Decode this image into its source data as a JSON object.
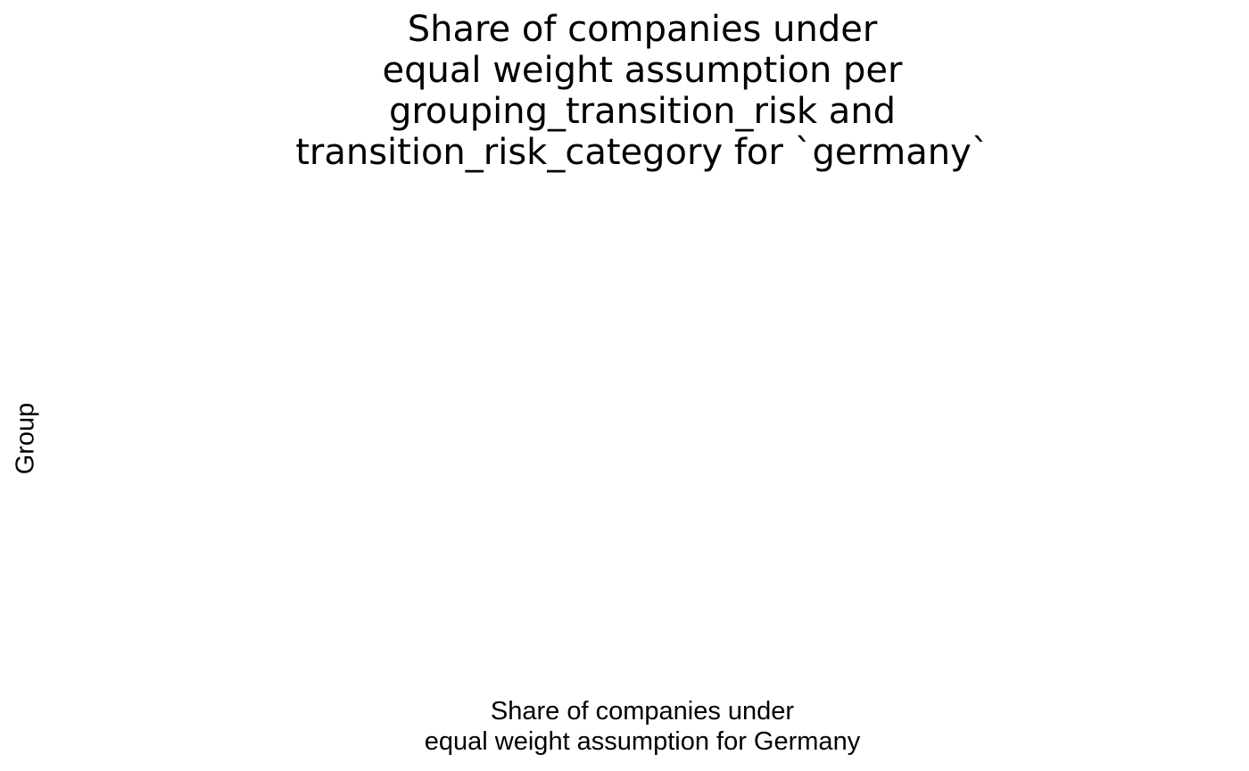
{
  "chart_data": {
    "type": "bar",
    "title_lines": [
      "Share of companies under",
      "equal weight assumption per",
      "grouping_transition_risk and",
      "transition_risk_category for `germany`"
    ],
    "xlabel_lines": [
      "Share of companies under",
      "equal weight assumption for Germany"
    ],
    "ylabel": "Group",
    "categories": [],
    "series": [],
    "grid": false,
    "legend": "none"
  }
}
